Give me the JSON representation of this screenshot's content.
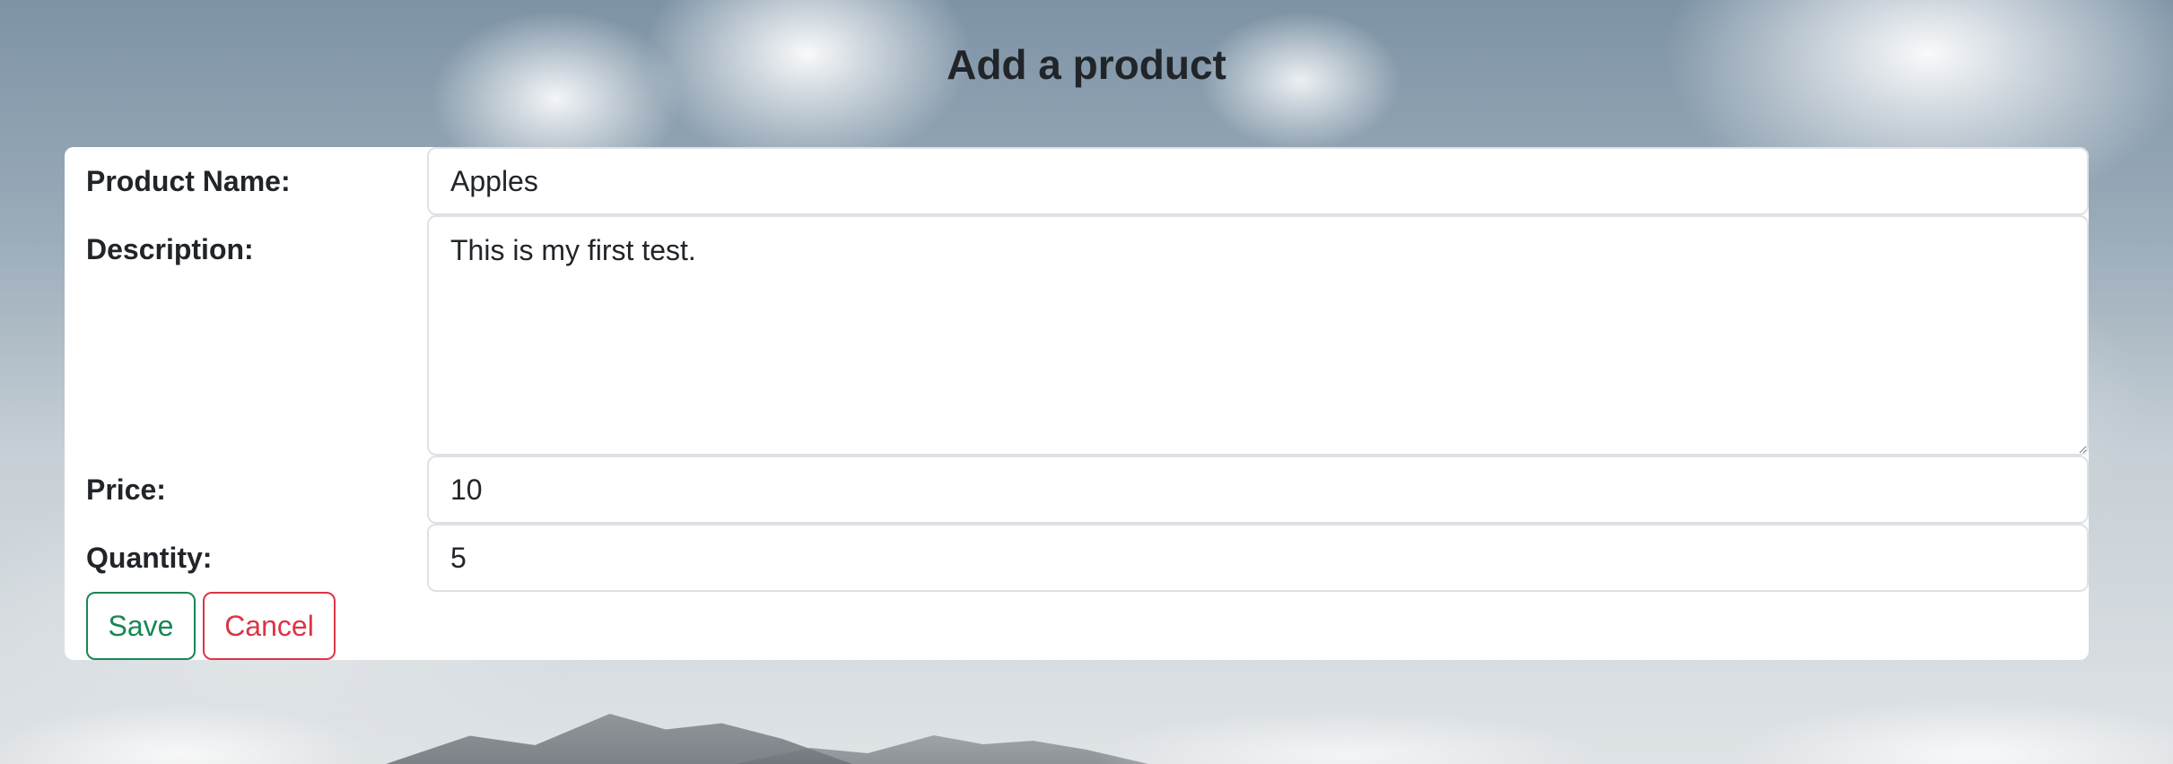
{
  "page": {
    "title": "Add a product"
  },
  "form": {
    "product_name": {
      "label": "Product Name:",
      "value": "Apples"
    },
    "description": {
      "label": "Description:",
      "value": "This is my first test."
    },
    "price": {
      "label": "Price:",
      "value": "10"
    },
    "quantity": {
      "label": "Quantity:",
      "value": "5"
    }
  },
  "actions": {
    "save_label": "Save",
    "cancel_label": "Cancel"
  },
  "colors": {
    "save": "#198754",
    "cancel": "#dc3545",
    "text": "#212529",
    "panel": "#ffffff"
  }
}
